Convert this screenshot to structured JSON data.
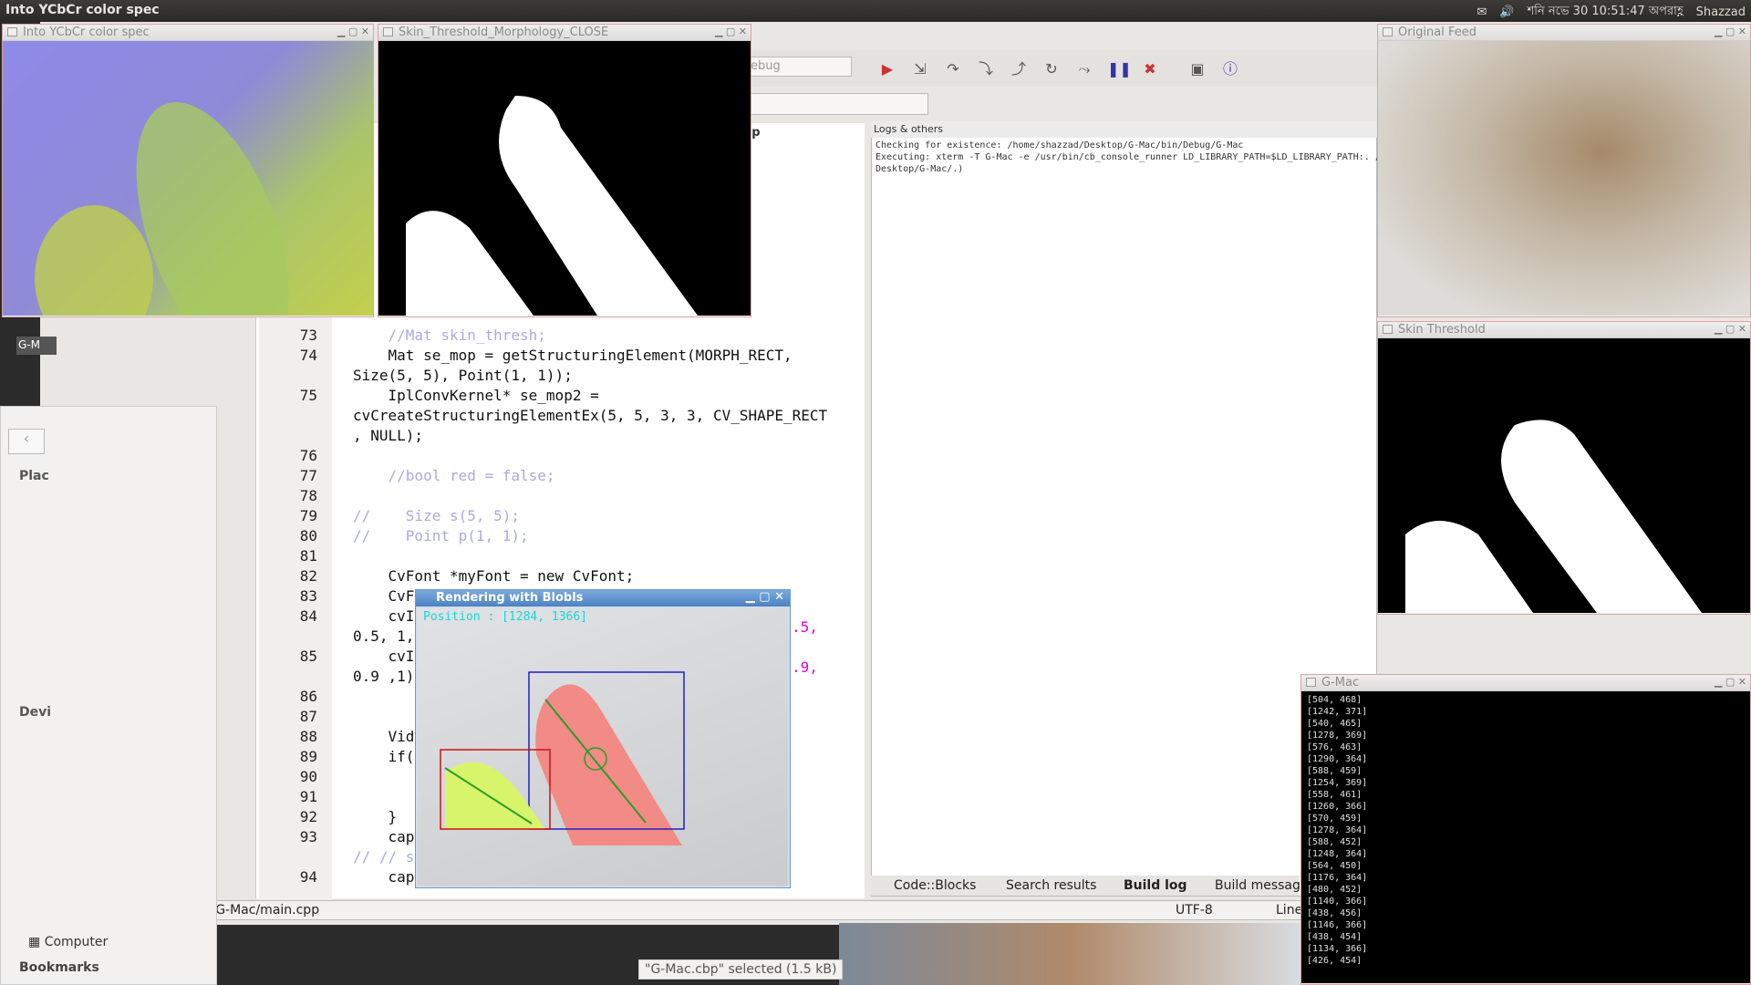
{
  "top_panel": {
    "title": "Into YCbCr color spec",
    "clock": "শনি নভে 30  10:51:47 অপরাহ্ণ",
    "user": "Shazzad"
  },
  "windows": {
    "ycbcr": {
      "title": "Into YCbCr color spec"
    },
    "close": {
      "title": "Skin_Threshold_Morphology_CLOSE"
    },
    "original": {
      "title": "Original Feed"
    },
    "skin": {
      "title": "Skin Threshold"
    },
    "blobs": {
      "title": "Rendering with Blobls",
      "position": "Position : [1284, 1366]"
    },
    "console": {
      "title": "G-Mac",
      "lines": [
        "[504, 468]",
        "[1242, 371]",
        "[540, 465]",
        "[1278, 369]",
        "[576, 463]",
        "[1290, 364]",
        "[588, 459]",
        "[1254, 369]",
        "[558, 461]",
        "[1260, 366]",
        "[570, 459]",
        "[1278, 364]",
        "[588, 452]",
        "[1248, 364]",
        "[564, 450]",
        "[1176, 364]",
        "[480, 452]",
        "[1140, 366]",
        "[438, 456]",
        "[1146, 366]",
        "[438, 454]",
        "[1134, 366]",
        "[426, 454]"
      ]
    }
  },
  "ide": {
    "debug_combo": "ebug",
    "editor_tab": "pp",
    "logs_header": "Logs & others",
    "log_lines": [
      "Checking for existence: /home/shazzad/Desktop/G-Mac/bin/Debug/G-Mac",
      "Executing: xterm -T G-Mac -e /usr/bin/cb_console_runner LD_LIBRARY_PATH=$LD_LIBRARY_PATH:. /",
      "Desktop/G-Mac/.)"
    ],
    "log_tabs": [
      "Code::Blocks",
      "Search results",
      "Build log",
      "Build message"
    ],
    "status_path": "/home/shazzad/Desktop/G-Mac/main.cpp",
    "status_encoding": "UTF-8",
    "status_line": "Line"
  },
  "code_lines": [
    {
      "n": "73",
      "text": "    //Mat skin_thresh;"
    },
    {
      "n": "74",
      "text": "    Mat se_mop = getStructuringElement(MORPH_RECT,"
    },
    {
      "n": "",
      "text": "Size(5, 5), Point(1, 1));"
    },
    {
      "n": "75",
      "text": "    IplConvKernel* se_mop2 ="
    },
    {
      "n": "",
      "text": "cvCreateStructuringElementEx(5, 5, 3, 3, CV_SHAPE_RECT"
    },
    {
      "n": "",
      "text": ", NULL);"
    },
    {
      "n": "76",
      "text": ""
    },
    {
      "n": "77",
      "text": "    //bool red = false;"
    },
    {
      "n": "78",
      "text": ""
    },
    {
      "n": "79",
      "text": "//    Size s(5, 5);"
    },
    {
      "n": "80",
      "text": "//    Point p(1, 1);"
    },
    {
      "n": "81",
      "text": ""
    },
    {
      "n": "82",
      "text": "    CvFont *myFont = new CvFont;"
    },
    {
      "n": "83",
      "text": "    CvF"
    },
    {
      "n": "84",
      "text": "    cvI"
    },
    {
      "n": "",
      "text": "0.5, 1,"
    },
    {
      "n": "85",
      "text": "    cvI"
    },
    {
      "n": "",
      "text": "0.9 ,1)"
    },
    {
      "n": "86",
      "text": ""
    },
    {
      "n": "87",
      "text": ""
    },
    {
      "n": "88",
      "text": "    Vid"
    },
    {
      "n": "89",
      "text": "    if("
    },
    {
      "n": "90",
      "text": ""
    },
    {
      "n": "91",
      "text": ""
    },
    {
      "n": "92",
      "text": "    }"
    },
    {
      "n": "93",
      "text": "    cap"
    },
    {
      "n": "",
      "text": "// // s"
    },
    {
      "n": "94",
      "text": "    cap"
    }
  ],
  "code_right_fragments": [
    ".5,",
    ".9,"
  ],
  "nautilus": {
    "places_header": "Plac",
    "devices_header": "Devi",
    "computer": "Computer",
    "bookmarks": "Bookmarks",
    "status": "\"G-Mac.cbp\" selected  (1.5 kB)",
    "taskbar_label": "G-M"
  },
  "colors": {
    "accent_blob_left": "#d7f46b",
    "accent_blob_right": "#f28a86",
    "bbox_red": "#d01010",
    "bbox_blue": "#2020c0"
  }
}
